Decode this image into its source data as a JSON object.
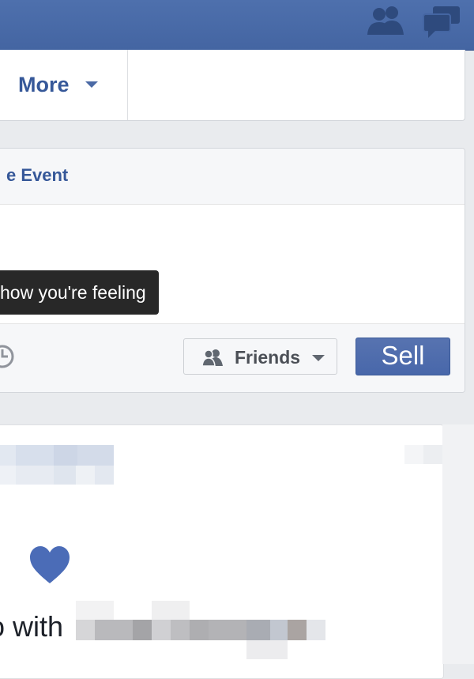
{
  "topbar": {
    "friend_requests_icon": "friends-icon",
    "messages_icon": "messages-icon"
  },
  "nav": {
    "more_label": "More"
  },
  "composer": {
    "event_tab_label": "e Event",
    "tooltip_text": "how you're feeling",
    "audience_label": "Friends",
    "sell_label": "Sell"
  },
  "post": {
    "text_fragment": "o with",
    "reaction_icon": "heart-icon"
  },
  "colors": {
    "brand_blue": "#4465a2",
    "link_blue": "#365899",
    "tooltip_bg": "#282828"
  }
}
